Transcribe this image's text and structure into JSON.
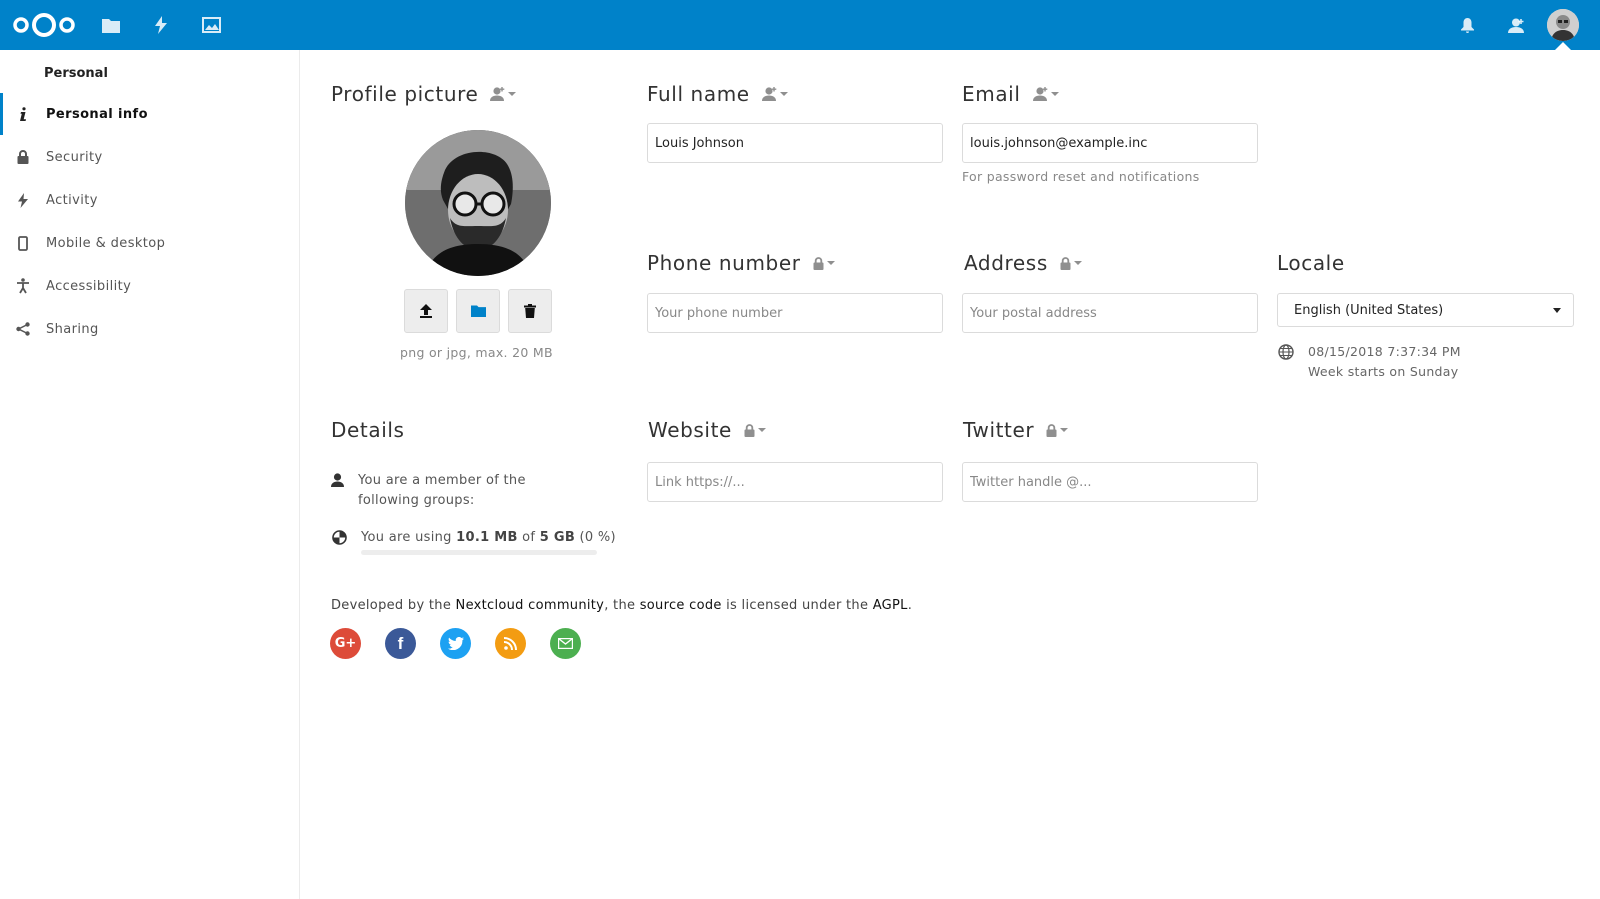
{
  "header": {
    "apps": [
      {
        "name": "Files",
        "icon": "folder-icon"
      },
      {
        "name": "Activity",
        "icon": "lightning-icon"
      },
      {
        "name": "Gallery",
        "icon": "image-icon"
      }
    ],
    "accent": "#0082c9"
  },
  "sidebar": {
    "section_title": "Personal",
    "items": [
      {
        "label": "Personal info",
        "icon": "info-icon",
        "active": true
      },
      {
        "label": "Security",
        "icon": "lock-icon"
      },
      {
        "label": "Activity",
        "icon": "lightning-icon"
      },
      {
        "label": "Mobile & desktop",
        "icon": "phone-icon"
      },
      {
        "label": "Accessibility",
        "icon": "accessibility-icon"
      },
      {
        "label": "Sharing",
        "icon": "share-icon"
      }
    ]
  },
  "profile": {
    "picture_title": "Profile picture",
    "picture_hint": "png or jpg, max. 20 MB",
    "fullname_title": "Full name",
    "fullname_value": "Louis Johnson",
    "email_title": "Email",
    "email_value": "louis.johnson@example.inc",
    "email_hint": "For password reset and notifications",
    "phone_title": "Phone number",
    "phone_placeholder": "Your phone number",
    "address_title": "Address",
    "address_placeholder": "Your postal address",
    "locale_title": "Locale",
    "locale_value": "English (United States)",
    "locale_time": "08/15/2018 7:37:34 PM",
    "locale_week": "Week starts on Sunday",
    "website_title": "Website",
    "website_placeholder": "Link https://...",
    "twitter_title": "Twitter",
    "twitter_placeholder": "Twitter handle @..."
  },
  "details": {
    "title": "Details",
    "groups_text": "You are a member of the following groups:",
    "quota_prefix": "You are using ",
    "quota_used": "10.1 MB",
    "quota_of": " of ",
    "quota_total": "5 GB",
    "quota_percent": " (0 %)",
    "quota_fraction": 0
  },
  "footer": {
    "prefix": "Developed by the ",
    "community_link": "Nextcloud community",
    "mid1": ", the ",
    "source_link": "source code",
    "mid2": " is licensed under the ",
    "license_link": "AGPL",
    "suffix": ".",
    "social": [
      {
        "name": "google-plus-icon",
        "color": "#dd4b39",
        "glyph": "G+"
      },
      {
        "name": "facebook-icon",
        "color": "#3b5998",
        "glyph": "f"
      },
      {
        "name": "twitter-icon",
        "color": "#1da1f2",
        "glyph": ""
      },
      {
        "name": "rss-icon",
        "color": "#f39c12",
        "glyph": ""
      },
      {
        "name": "mail-icon",
        "color": "#4caf50",
        "glyph": ""
      }
    ]
  }
}
